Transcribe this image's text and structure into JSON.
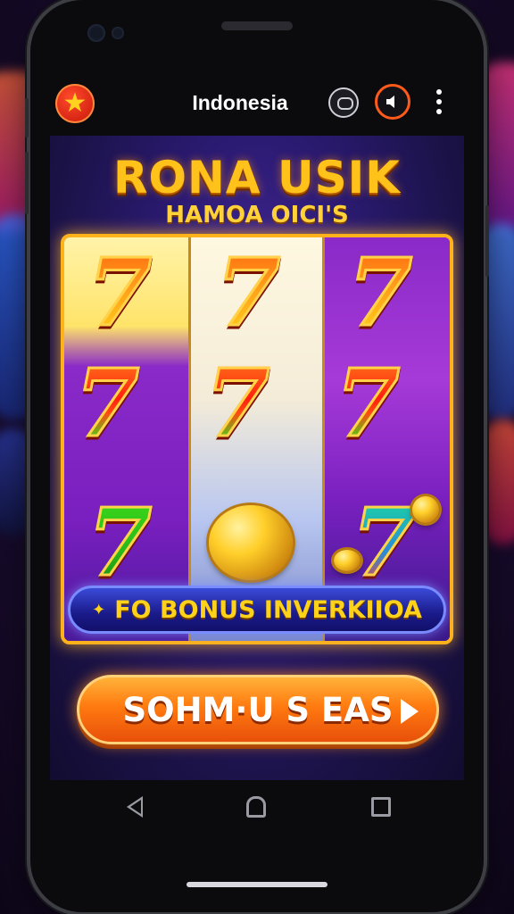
{
  "app_bar": {
    "country": "Indonesia",
    "flag_icon": "star-flag-icon",
    "chat_icon": "chat-bubble-icon",
    "sound_icon": "speaker-icon",
    "more_icon": "more-vertical-icon"
  },
  "game": {
    "title": "RONA USIK",
    "subtitle": "HAMOA OICI'S",
    "reels": [
      [
        "7",
        "7",
        "7"
      ],
      [
        "7",
        "7",
        "coin"
      ],
      [
        "7",
        "7",
        "7"
      ]
    ],
    "bonus_text": "FO BONUS INVERKIIOA",
    "cta_label": "SOHM·U S EAS"
  },
  "nav_bar": {
    "back_icon": "back-triangle-icon",
    "home_icon": "home-icon",
    "recents_icon": "recents-square-icon"
  },
  "colors": {
    "title_gold": "#ffc21a",
    "cta_orange": "#ff7a10",
    "banner_blue": "#1a1a8a",
    "flag_red": "#c4140a"
  }
}
